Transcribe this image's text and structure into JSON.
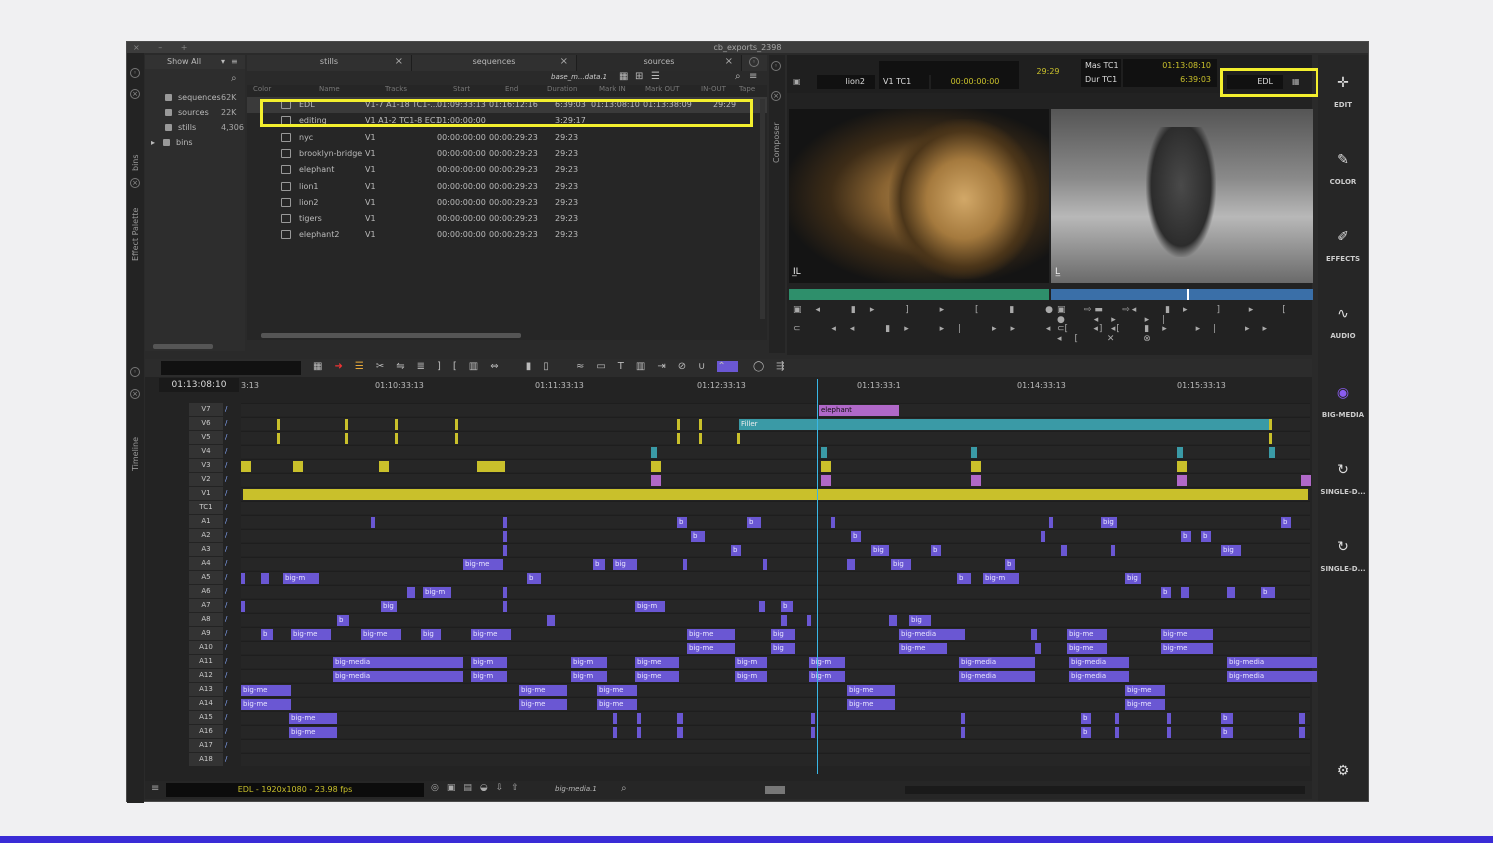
{
  "window": {
    "title": "cb_exports_2398"
  },
  "bins_panel": {
    "show_label": "Show All",
    "tab_label": "bins",
    "items": [
      {
        "name": "sequences",
        "count": "62K"
      },
      {
        "name": "sources",
        "count": "22K"
      },
      {
        "name": "stills",
        "count": "4,306"
      },
      {
        "name": "bins",
        "count": ""
      }
    ]
  },
  "side_labels": {
    "effect_palette": "Effect Palette",
    "composer": "Composer",
    "timeline": "Timeline"
  },
  "bin_tabs": [
    {
      "label": "stills"
    },
    {
      "label": "sequences"
    },
    {
      "label": "sources"
    }
  ],
  "bin_toolbar": {
    "dropdown": "base_m...data.1"
  },
  "bin_columns": [
    "Color",
    "Name",
    "Tracks",
    "Start",
    "End",
    "Duration",
    "Mark IN",
    "Mark OUT",
    "IN-OUT",
    "Tape"
  ],
  "bin_rows": [
    {
      "name": "EDL",
      "tracks": "V1-7 A1-18 TC1-...",
      "start": "01:09:33:13",
      "end": "01:16:12:16",
      "duration": "6:39:03",
      "mark_in": "01:13:08:10",
      "mark_out": "01:13:38:09",
      "in_out": "29:29"
    },
    {
      "name": "editing",
      "tracks": "V1 A1-2 TC1-8 EC1",
      "start": "01:00:00:00",
      "end": "",
      "duration": "3:29:17",
      "mark_in": "",
      "mark_out": "",
      "in_out": ""
    },
    {
      "name": "nyc",
      "tracks": "V1",
      "start": "00:00:00:00",
      "end": "00:00:29:23",
      "duration": "29:23",
      "mark_in": "",
      "mark_out": "",
      "in_out": ""
    },
    {
      "name": "brooklyn-bridge",
      "tracks": "V1",
      "start": "00:00:00:00",
      "end": "00:00:29:23",
      "duration": "29:23",
      "mark_in": "",
      "mark_out": "",
      "in_out": ""
    },
    {
      "name": "elephant",
      "tracks": "V1",
      "start": "00:00:00:00",
      "end": "00:00:29:23",
      "duration": "29:23",
      "mark_in": "",
      "mark_out": "",
      "in_out": ""
    },
    {
      "name": "lion1",
      "tracks": "V1",
      "start": "00:00:00:00",
      "end": "00:00:29:23",
      "duration": "29:23",
      "mark_in": "",
      "mark_out": "",
      "in_out": ""
    },
    {
      "name": "lion2",
      "tracks": "V1",
      "start": "00:00:00:00",
      "end": "00:00:29:23",
      "duration": "29:23",
      "mark_in": "",
      "mark_out": "",
      "in_out": ""
    },
    {
      "name": "tigers",
      "tracks": "V1",
      "start": "00:00:00:00",
      "end": "00:00:29:23",
      "duration": "29:23",
      "mark_in": "",
      "mark_out": "",
      "in_out": ""
    },
    {
      "name": "elephant2",
      "tracks": "V1",
      "start": "00:00:00:00",
      "end": "00:00:29:23",
      "duration": "29:23",
      "mark_in": "",
      "mark_out": "",
      "in_out": ""
    }
  ],
  "composer": {
    "source_clip": "lion2",
    "source_track": "V1 TC1",
    "source_tc": "00:00:00:00",
    "center_dur": "29:29",
    "mas_label": "Mas TC1",
    "mas_tc": "01:13:08:10",
    "dur_label": "Dur TC1",
    "dur_tc": "6:39:03",
    "record_sequence": "EDL"
  },
  "right_toolbar": [
    "EDIT",
    "COLOR",
    "EFFECTS",
    "AUDIO",
    "BIG-MEDIA",
    "SINGLE-D...",
    "SINGLE-D..."
  ],
  "timeline": {
    "timecode": "01:13:08:10",
    "ruler": [
      "3:13",
      "01:10:33:13",
      "01:11:33:13",
      "01:12:33:13",
      "01:13:33:1",
      "01:14:33:13",
      "01:15:33:13"
    ],
    "video_tracks": [
      "V7",
      "V6",
      "V5",
      "V4",
      "V3",
      "V2",
      "V1"
    ],
    "tc_track": "TC1",
    "audio_tracks": [
      "A1",
      "A2",
      "A3",
      "A4",
      "A5",
      "A6",
      "A7",
      "A8",
      "A9",
      "A10",
      "A11",
      "A12",
      "A13",
      "A14",
      "A15",
      "A16",
      "A17",
      "A18"
    ],
    "filler_label": "Filler",
    "elephant_label": "elephant",
    "clip_labels": {
      "big_media": "big-media",
      "big_me": "big-me",
      "big_m": "big-m",
      "big": "big",
      "b": "b"
    },
    "status": "EDL - 1920x1080 - 23.98 fps",
    "media_dropdown": "big-media.1"
  },
  "colors": {
    "highlight": "#f3ef2e",
    "audio_clip": "#6a57d3",
    "video_clip": "#c9c02b",
    "playhead": "#39b7e6"
  }
}
